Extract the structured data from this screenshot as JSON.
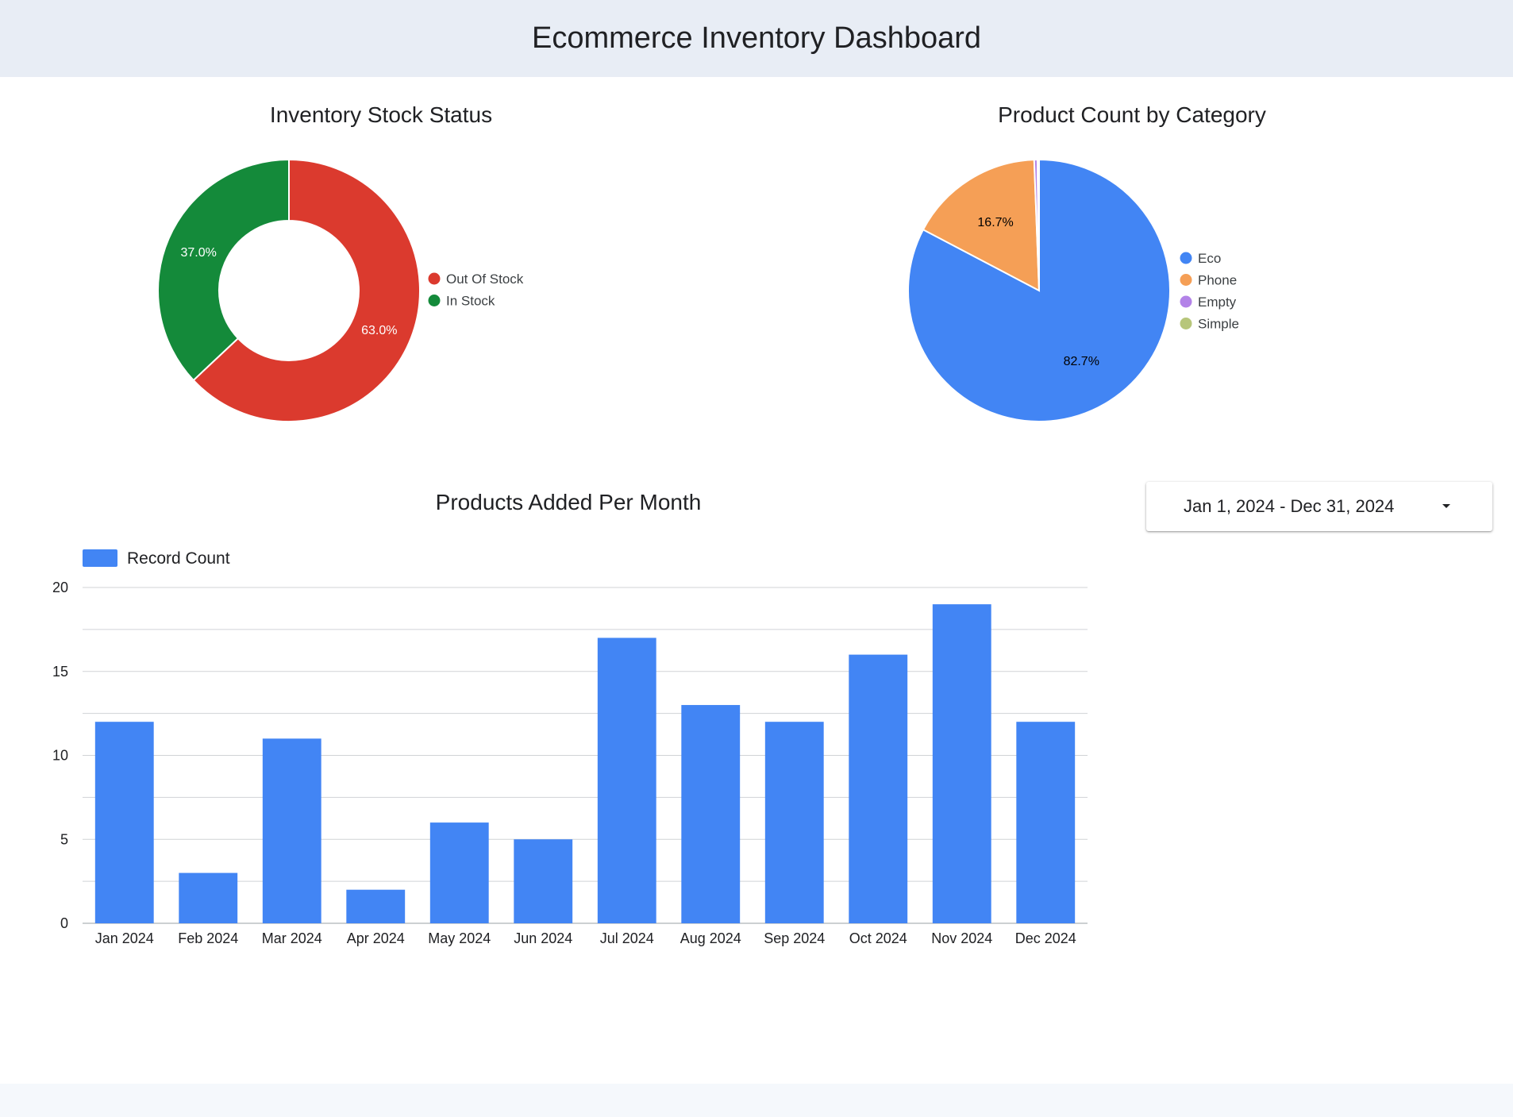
{
  "dashboard": {
    "title": "Ecommerce Inventory Dashboard"
  },
  "date_range": {
    "value": "Jan 1, 2024 - Dec 31, 2024"
  },
  "colors": {
    "header_bg": "#e8edf5",
    "red": "#db3a2e",
    "green": "#148a3a",
    "blue": "#4285f4",
    "orange": "#f59f56",
    "purple": "#b383e8",
    "olive": "#b7c67a"
  },
  "chart_data": [
    {
      "type": "pie",
      "variant": "donut",
      "title": "Inventory Stock Status",
      "categories": [
        "Out Of Stock",
        "In Stock"
      ],
      "values": [
        63.0,
        37.0
      ],
      "labels": [
        "63.0%",
        "37.0%"
      ],
      "colors": [
        "#db3a2e",
        "#148a3a"
      ],
      "legend": "right"
    },
    {
      "type": "pie",
      "title": "Product Count by Category",
      "categories": [
        "Eco",
        "Phone",
        "Empty",
        "Simple"
      ],
      "values": [
        82.7,
        16.7,
        0.4,
        0.2
      ],
      "labels": [
        "82.7%",
        "16.7%",
        "",
        ""
      ],
      "colors": [
        "#4285f4",
        "#f59f56",
        "#b383e8",
        "#b7c67a"
      ],
      "legend": "right"
    },
    {
      "type": "bar",
      "title": "Products Added Per Month",
      "categories": [
        "Jan 2024",
        "Feb 2024",
        "Mar 2024",
        "Apr 2024",
        "May 2024",
        "Jun 2024",
        "Jul 2024",
        "Aug 2024",
        "Sep 2024",
        "Oct 2024",
        "Nov 2024",
        "Dec 2024"
      ],
      "series": [
        {
          "name": "Record Count",
          "values": [
            12,
            3,
            11,
            2,
            6,
            5,
            17,
            13,
            12,
            16,
            19,
            12
          ],
          "color": "#4285f4"
        }
      ],
      "ylim": [
        0,
        20
      ],
      "yticks": [
        0,
        5,
        10,
        15,
        20
      ],
      "grid": true,
      "legend": "top-left"
    }
  ]
}
